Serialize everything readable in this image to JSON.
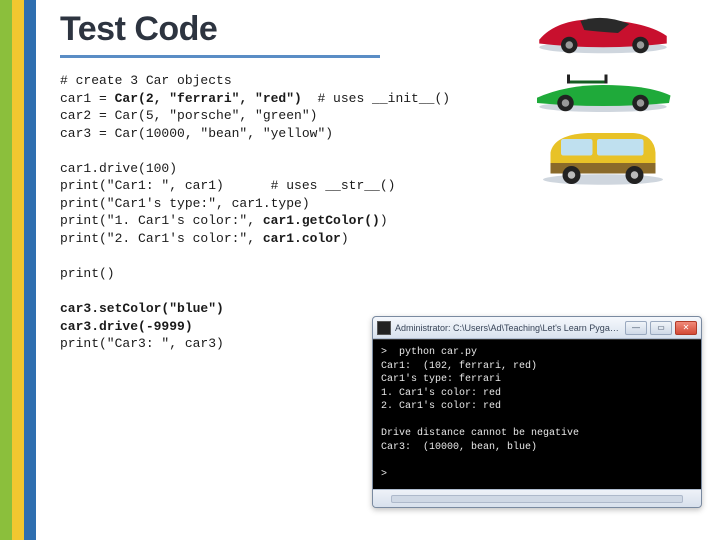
{
  "title": "Test Code",
  "code": {
    "blocks": [
      [
        {
          "plain": "# create 3 Car objects"
        },
        {
          "plain": "car1 = ",
          "bold": "Car(2, \"ferrari\", \"red\")",
          "tail": "  # uses __init__()"
        },
        {
          "plain": "car2 = Car(5, \"porsche\", \"green\")"
        },
        {
          "plain": "car3 = Car(10000, \"bean\", \"yellow\")"
        }
      ],
      [
        {
          "plain": "car1.drive(100)"
        },
        {
          "plain": "print(\"Car1: \", car1)      # uses __str__()"
        },
        {
          "plain": "print(\"Car1's type:\", car1.type)"
        },
        {
          "plain": "print(\"1. Car1's color:\", ",
          "bold": "car1.getColor()",
          "tail": ")"
        },
        {
          "plain": "print(\"2. Car1's color:\", ",
          "bold": "car1.color",
          "tail": ")"
        }
      ],
      [
        {
          "plain": "print()"
        }
      ],
      [
        {
          "bold": "car3.setColor(\"blue\")"
        },
        {
          "bold": "car3.drive(-9999)"
        },
        {
          "plain": "print(\"Car3: \", car3)"
        }
      ]
    ]
  },
  "terminal": {
    "title": "Administrator: C:\\Users\\Ad\\Teaching\\Let's Learn Pygame\\...",
    "output_lines": [
      ">  python car.py",
      "Car1:  (102, ferrari, red)",
      "Car1's type: ferrari",
      "1. Car1's color: red",
      "2. Car1's color: red",
      "",
      "Drive distance cannot be negative",
      "Car3:  (10000, bean, blue)",
      "",
      ">"
    ],
    "buttons": {
      "min": "—",
      "max": "▭",
      "close": "✕"
    }
  },
  "cars": {
    "red": {
      "name": "red-sports-car"
    },
    "green": {
      "name": "green-convertible-car"
    },
    "yellow": {
      "name": "yellow-mini-car"
    }
  }
}
